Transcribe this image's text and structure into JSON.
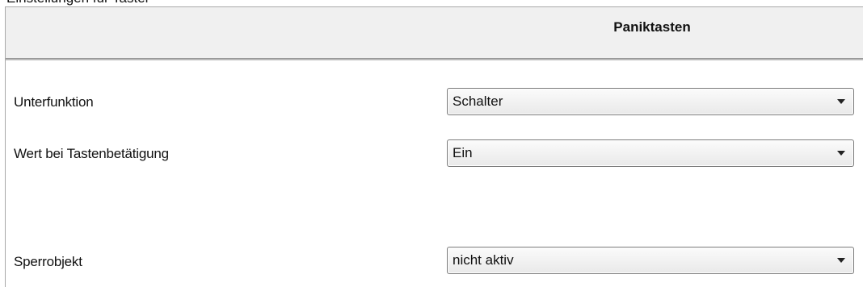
{
  "top_cut_text": "Einstellungen für Taster",
  "header": {
    "title": "Paniktasten"
  },
  "rows": [
    {
      "label": "Unterfunktion",
      "value": "Schalter"
    },
    {
      "label": "Wert bei Tastenbetätigung",
      "value": "Ein"
    },
    {
      "label": "Sperrobjekt",
      "value": "nicht aktiv"
    }
  ],
  "icons": {
    "dropdown": "chevron-down-icon"
  }
}
